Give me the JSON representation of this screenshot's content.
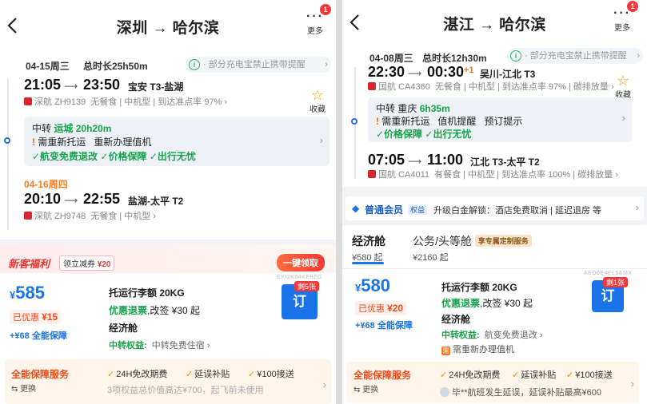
{
  "left": {
    "header": {
      "route": "深圳 → 哈尔滨",
      "more_label": "更多",
      "badge": "1"
    },
    "date1": "04-15周三",
    "duration": "总时长25h50m",
    "notice": "· 部分充电宝禁止携带提醒",
    "seg1": {
      "dep": "21:05",
      "arr": "23:50",
      "arrow": "⟶",
      "airport": "宝安 T3-盐湖",
      "airline": "深航 ZH9139",
      "info": "无餐食 | 中机型 | 到达准点率 97% ›"
    },
    "fav": {
      "icon": "star-icon",
      "label": "收藏"
    },
    "transfer": {
      "prefix": "中转",
      "city": "运城",
      "dur": "20h20m",
      "warn": "需重新托运",
      "warn2": "重新办理值机",
      "perks": [
        "✓航变免费退改",
        "✓价格保障",
        "✓出行无忧"
      ]
    },
    "date2": "04-16周四",
    "seg2": {
      "dep": "20:10",
      "arr": "22:55",
      "arrow": "⟶",
      "airport": "盐湖-太平 T2",
      "airline": "深航 ZH9748",
      "info": "无餐食 | 中机型 ›"
    },
    "promo": {
      "title": "新客福利",
      "coupon_prefix": "领立减券",
      "coupon_value": "¥20",
      "claim": "一键领取"
    },
    "offer": {
      "currency": "¥",
      "price": "585",
      "discount_label": "已优惠",
      "discount_value": "¥15",
      "plus": "+¥68 全能保障",
      "bag": "托运行李额 20KG",
      "refund_hl": "优惠退票",
      "refund_rest": ",改签 ¥30 起",
      "cabin": "经济舱",
      "rights_label": "中转权益:",
      "rights_value": "中转免费住宿 ›",
      "book": "订",
      "seats": "剩5张",
      "code": "EXI2K64KE9ZG"
    },
    "guard": {
      "title": "全能保障服务",
      "switch": "⇆ 更换",
      "items": [
        "24H免改期费",
        "延误补贴",
        "¥100接送"
      ]
    },
    "footer": "3项权益总价值高达¥700，起飞前未使用"
  },
  "right": {
    "header": {
      "route": "湛江 → 哈尔滨",
      "more_label": "更多",
      "badge": "1"
    },
    "date1": "04-08周三",
    "duration": "总时长12h30m",
    "notice": "· 部分充电宝禁止携带提醒",
    "seg1": {
      "dep": "22:30",
      "arr": "00:30",
      "plusone": "+1",
      "arrow": "⟶",
      "airport": "吴川-江北 T3",
      "airline": "国航 CA4360",
      "info": "无餐食 | 中机型 | 到达准点率 97% | 碳排放量 ›"
    },
    "fav": {
      "icon": "star-icon",
      "label": "收藏"
    },
    "transfer": {
      "prefix": "中转",
      "city": "重庆",
      "dur": "6h35m",
      "warn": "需重新托运",
      "warn2": "值机提醒",
      "warn3": "预订提示",
      "perks": [
        "✓价格保障",
        "✓出行无忧"
      ]
    },
    "seg2": {
      "dep": "07:05",
      "arr": "11:00",
      "arrow": "⟶",
      "airport": "江北 T3-太平 T2",
      "airline": "国航 CA4011",
      "info": "有餐食 | 中机型 | 到达准点率 100% | 碳排放量 ›"
    },
    "member": {
      "name": "普通会员",
      "tag": "权益",
      "text": "升级白金解锁：酒店免费取消 | 延迟退房 等"
    },
    "tabs": [
      {
        "name": "经济舱",
        "sub": "¥580 起"
      },
      {
        "name": "公务/头等舱",
        "sub": "¥2160 起",
        "tag": "享专属定制服务"
      }
    ],
    "offer": {
      "currency": "¥",
      "price": "580",
      "discount_label": "已优惠",
      "discount_value": "¥20",
      "plus": "+¥68 全能保障",
      "bag": "托运行李额 20KG",
      "refund_hl": "优惠退票",
      "refund_rest": ",改签 ¥30 起",
      "cabin": "经济舱",
      "rights_label": "中转权益:",
      "rights_value": "航变免费退改 ›",
      "rebook_icon": "需",
      "rebook": "需重新办理值机",
      "book": "订",
      "seats": "剩1张",
      "code": "AED0E4EL5AMX"
    },
    "guard": {
      "title": "全能保障服务",
      "switch": "⇆ 更换",
      "items": [
        "24H免改期费",
        "延误补贴",
        "¥100接送"
      ]
    },
    "footer": "毕**航班发生延误，延误补贴最高¥600"
  }
}
